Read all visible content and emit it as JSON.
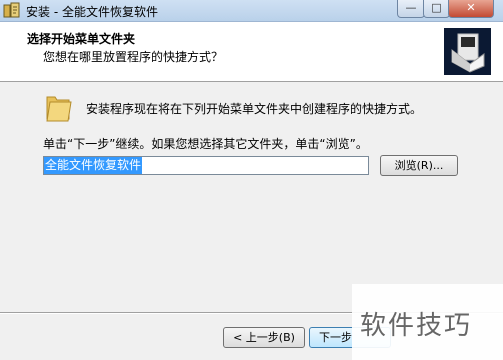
{
  "window": {
    "title": "安装 - 全能文件恢复软件",
    "icon": "installer-icon",
    "controls": {
      "minimize": "—",
      "maximize": "□",
      "close": "✕"
    }
  },
  "header": {
    "title": "选择开始菜单文件夹",
    "subtitle": "您想在哪里放置程序的快捷方式？",
    "logo_icon": "computer-box-icon"
  },
  "main": {
    "intro": "安装程序现在将在下列开始菜单文件夹中创建程序的快捷方式。",
    "instruction": "单击“下一步”继续。如果您想选择其它文件夹，单击“浏览”。",
    "folder_value": "全能文件恢复软件",
    "browse_label": "浏览(R)..."
  },
  "footer": {
    "back_label": "< 上一步(B)",
    "next_label": "下一步"
  },
  "watermark": "软件技巧",
  "colors": {
    "selection": "#3399ff",
    "titlebar": "#b9d1ea",
    "close_button": "#c24a33"
  }
}
